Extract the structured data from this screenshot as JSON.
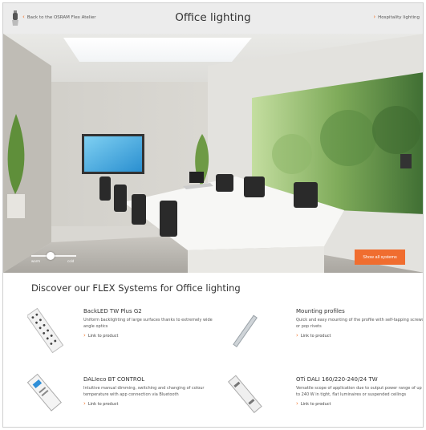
{
  "header": {
    "back_label": "Back to the OSRAM Flex Atelier",
    "title": "Office lighting",
    "next_label": "Hospitality lighting"
  },
  "hero": {
    "show_all_label": "Show all systems",
    "slider": {
      "left_label": "warm",
      "right_label": "cold",
      "level": 0.38
    }
  },
  "section": {
    "title": "Discover our FLEX Systems for Office lighting"
  },
  "products": [
    {
      "name": "BackLED TW Plus G2",
      "desc": "Uniform backlighting of large surfaces thanks to extremely wide angle optics",
      "link": "Link to product"
    },
    {
      "name": "Mounting profiles",
      "desc": "Quick and easy mounting of the profile with self-tapping screws or pop rivets",
      "link": "Link to product"
    },
    {
      "name": "DALIeco BT CONTROL",
      "desc": "Intuitive manual dimming, switching and changing of colour temperature with app connection via Bluetooth",
      "link": "Link to product"
    },
    {
      "name": "OTi DALI 160/220-240/24 TW",
      "desc": "Versatile scope of application due to output power range of up to 240 W in tight, flat luminaires or suspended ceilings",
      "link": "Link to product"
    }
  ],
  "colors": {
    "accent": "#f06d2f",
    "header_bg": "#ececec"
  }
}
